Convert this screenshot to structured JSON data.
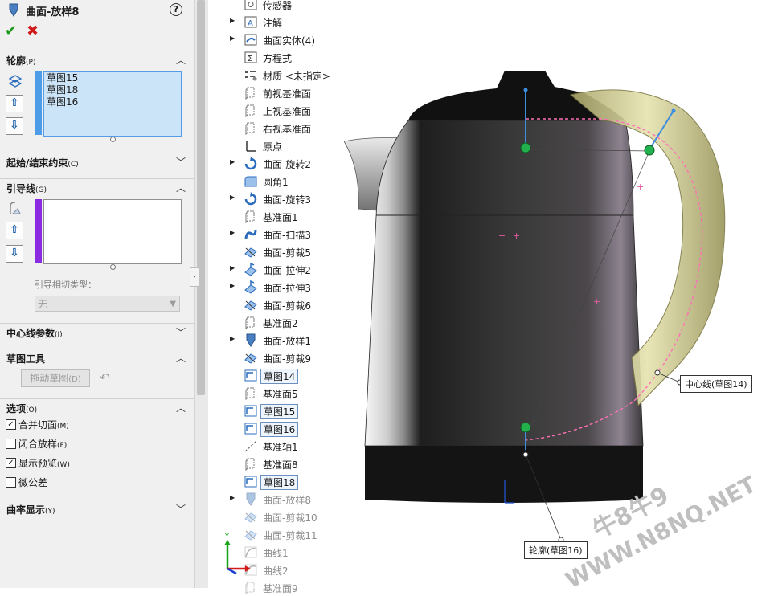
{
  "property_manager": {
    "title": "曲面-放样8",
    "help_glyph": "?",
    "ok_glyph": "✔",
    "cancel_glyph": "✖",
    "profile_section": {
      "label": "轮廓",
      "hotkey": "(P)",
      "items": [
        "草图15",
        "草图18",
        "草图16"
      ],
      "up_glyph": "⇧",
      "down_glyph": "⇩"
    },
    "start_end_section": {
      "label": "起始/结束约束",
      "hotkey": "(C)"
    },
    "guide_section": {
      "label": "引导线",
      "hotkey": "(G)",
      "up_glyph": "⇧",
      "down_glyph": "⇩",
      "tangent_label": "引导相切类型：",
      "tangent_value": "无"
    },
    "centerline_section": {
      "label": "中心线参数",
      "hotkey": "(I)"
    },
    "sketch_tools_section": {
      "label": "草图工具",
      "drag_button": "拖动草图",
      "drag_hotkey": "(D)"
    },
    "options_section": {
      "label": "选项",
      "hotkey": "(O)",
      "options": [
        {
          "label": "合并切面",
          "hotkey": "(M)",
          "checked": true
        },
        {
          "label": "闭合放样",
          "hotkey": "(F)",
          "checked": false
        },
        {
          "label": "显示预览",
          "hotkey": "(W)",
          "checked": true
        },
        {
          "label": "微公差",
          "hotkey": "",
          "checked": false
        }
      ]
    },
    "curvature_section": {
      "label": "曲率显示",
      "hotkey": "(Y)"
    },
    "colors": {
      "profile_bar": "#4d9ce8",
      "guide_bar": "#8a2be2",
      "selection": "#cce4f7"
    }
  },
  "feature_tree": {
    "items": [
      {
        "label": "传感器",
        "icon": "sensor-icon",
        "expandable": false
      },
      {
        "label": "注解",
        "icon": "annotation-icon",
        "expandable": true
      },
      {
        "label": "曲面实体(4)",
        "icon": "surface-bodies-icon",
        "expandable": true
      },
      {
        "label": "方程式",
        "icon": "equations-icon",
        "expandable": false
      },
      {
        "label": "材质 <未指定>",
        "icon": "material-icon",
        "expandable": false
      },
      {
        "label": "前视基准面",
        "icon": "plane-icon",
        "expandable": false
      },
      {
        "label": "上视基准面",
        "icon": "plane-icon",
        "expandable": false
      },
      {
        "label": "右视基准面",
        "icon": "plane-icon",
        "expandable": false
      },
      {
        "label": "原点",
        "icon": "origin-icon",
        "expandable": false
      },
      {
        "label": "曲面-旋转2",
        "icon": "revolve-surface-icon",
        "expandable": true
      },
      {
        "label": "圆角1",
        "icon": "fillet-icon",
        "expandable": false
      },
      {
        "label": "曲面-旋转3",
        "icon": "revolve-surface-icon",
        "expandable": true
      },
      {
        "label": "基准面1",
        "icon": "plane-icon",
        "expandable": false
      },
      {
        "label": "曲面-扫描3",
        "icon": "sweep-surface-icon",
        "expandable": true
      },
      {
        "label": "曲面-剪裁5",
        "icon": "trim-surface-icon",
        "expandable": false
      },
      {
        "label": "曲面-拉伸2",
        "icon": "extrude-surface-icon",
        "expandable": true
      },
      {
        "label": "曲面-拉伸3",
        "icon": "extrude-surface-icon",
        "expandable": true
      },
      {
        "label": "曲面-剪裁6",
        "icon": "trim-surface-icon",
        "expandable": false
      },
      {
        "label": "基准面2",
        "icon": "plane-icon",
        "expandable": false
      },
      {
        "label": "曲面-放样1",
        "icon": "loft-surface-icon",
        "expandable": true
      },
      {
        "label": "曲面-剪裁9",
        "icon": "trim-surface-icon",
        "expandable": false
      },
      {
        "label": "草图14",
        "icon": "sketch-icon",
        "expandable": false,
        "boxed": true
      },
      {
        "label": "基准面5",
        "icon": "plane-icon",
        "expandable": false
      },
      {
        "label": "草图15",
        "icon": "sketch-icon",
        "expandable": false,
        "boxed": true
      },
      {
        "label": "草图16",
        "icon": "sketch-icon",
        "expandable": false,
        "boxed": true
      },
      {
        "label": "基准轴1",
        "icon": "axis-icon",
        "expandable": false
      },
      {
        "label": "基准面8",
        "icon": "plane-icon",
        "expandable": false
      },
      {
        "label": "草图18",
        "icon": "sketch-icon",
        "expandable": false,
        "boxed": true
      },
      {
        "label": "曲面-放样8",
        "icon": "loft-surface-icon",
        "expandable": true,
        "dim": true
      },
      {
        "label": "曲面-剪裁10",
        "icon": "trim-surface-icon",
        "expandable": false,
        "dim": true
      },
      {
        "label": "曲面-剪裁11",
        "icon": "trim-surface-icon",
        "expandable": false,
        "dim": true
      },
      {
        "label": "曲线1",
        "icon": "curve-icon",
        "expandable": false,
        "dim": true
      },
      {
        "label": "曲线2",
        "icon": "curve-icon",
        "expandable": false,
        "dim": true
      },
      {
        "label": "基准面9",
        "icon": "plane-icon",
        "expandable": false,
        "dim": true
      }
    ]
  },
  "viewport": {
    "callout_centerline": "中心线(草图14)",
    "callout_profile": "轮廓(草图16)",
    "axis_label": "Y",
    "watermark_cn": "牛8牛9",
    "watermark_en": "WWW.N8NQ.NET"
  }
}
